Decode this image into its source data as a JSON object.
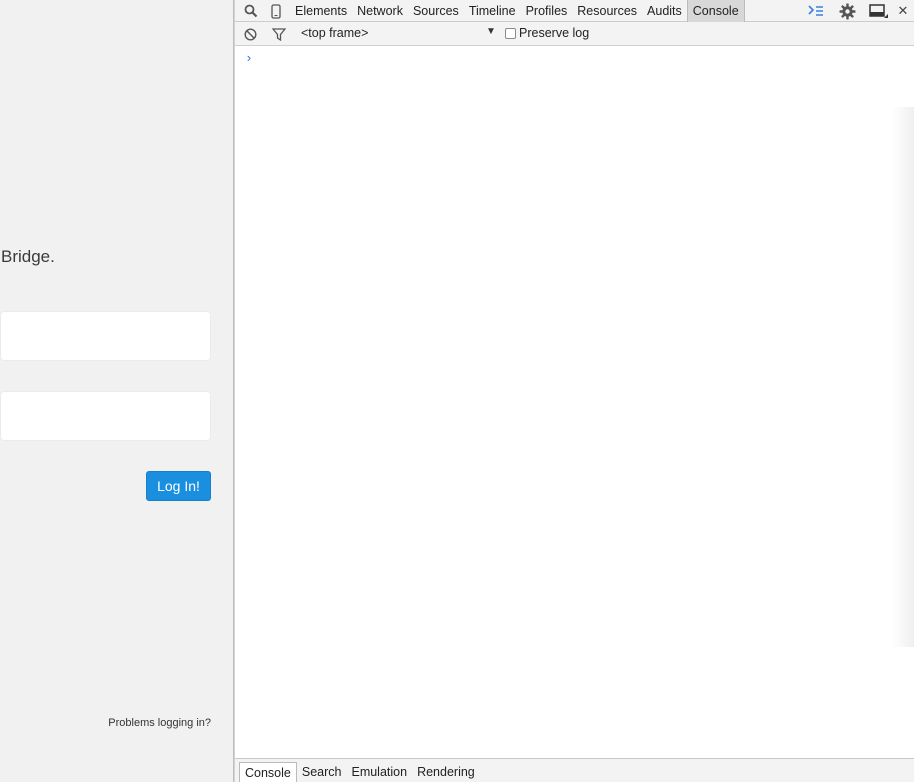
{
  "page": {
    "tagline": "Bridge.",
    "username_placeholder": "",
    "password_placeholder": "",
    "login_button": "Log In!",
    "problems_link": "Problems logging in?",
    "accent_color": "#1a8fe0"
  },
  "devtools": {
    "tabs": [
      {
        "label": "Elements",
        "active": false
      },
      {
        "label": "Network",
        "active": false
      },
      {
        "label": "Sources",
        "active": false
      },
      {
        "label": "Timeline",
        "active": false
      },
      {
        "label": "Profiles",
        "active": false
      },
      {
        "label": "Resources",
        "active": false
      },
      {
        "label": "Audits",
        "active": false
      },
      {
        "label": "Console",
        "active": true
      }
    ],
    "icons": {
      "search": "search-icon",
      "device": "device-mode-icon",
      "drawer": "show-drawer-icon",
      "settings": "gear-icon",
      "dock": "dock-side-icon",
      "close": "close-icon"
    },
    "toolbar": {
      "frame_label": "<top frame>",
      "preserve_log_label": "Preserve log",
      "preserve_log_checked": false
    },
    "console": {
      "prompt": "›"
    },
    "drawer_tabs": [
      {
        "label": "Console",
        "active": true
      },
      {
        "label": "Search",
        "active": false
      },
      {
        "label": "Emulation",
        "active": false
      },
      {
        "label": "Rendering",
        "active": false
      }
    ]
  }
}
